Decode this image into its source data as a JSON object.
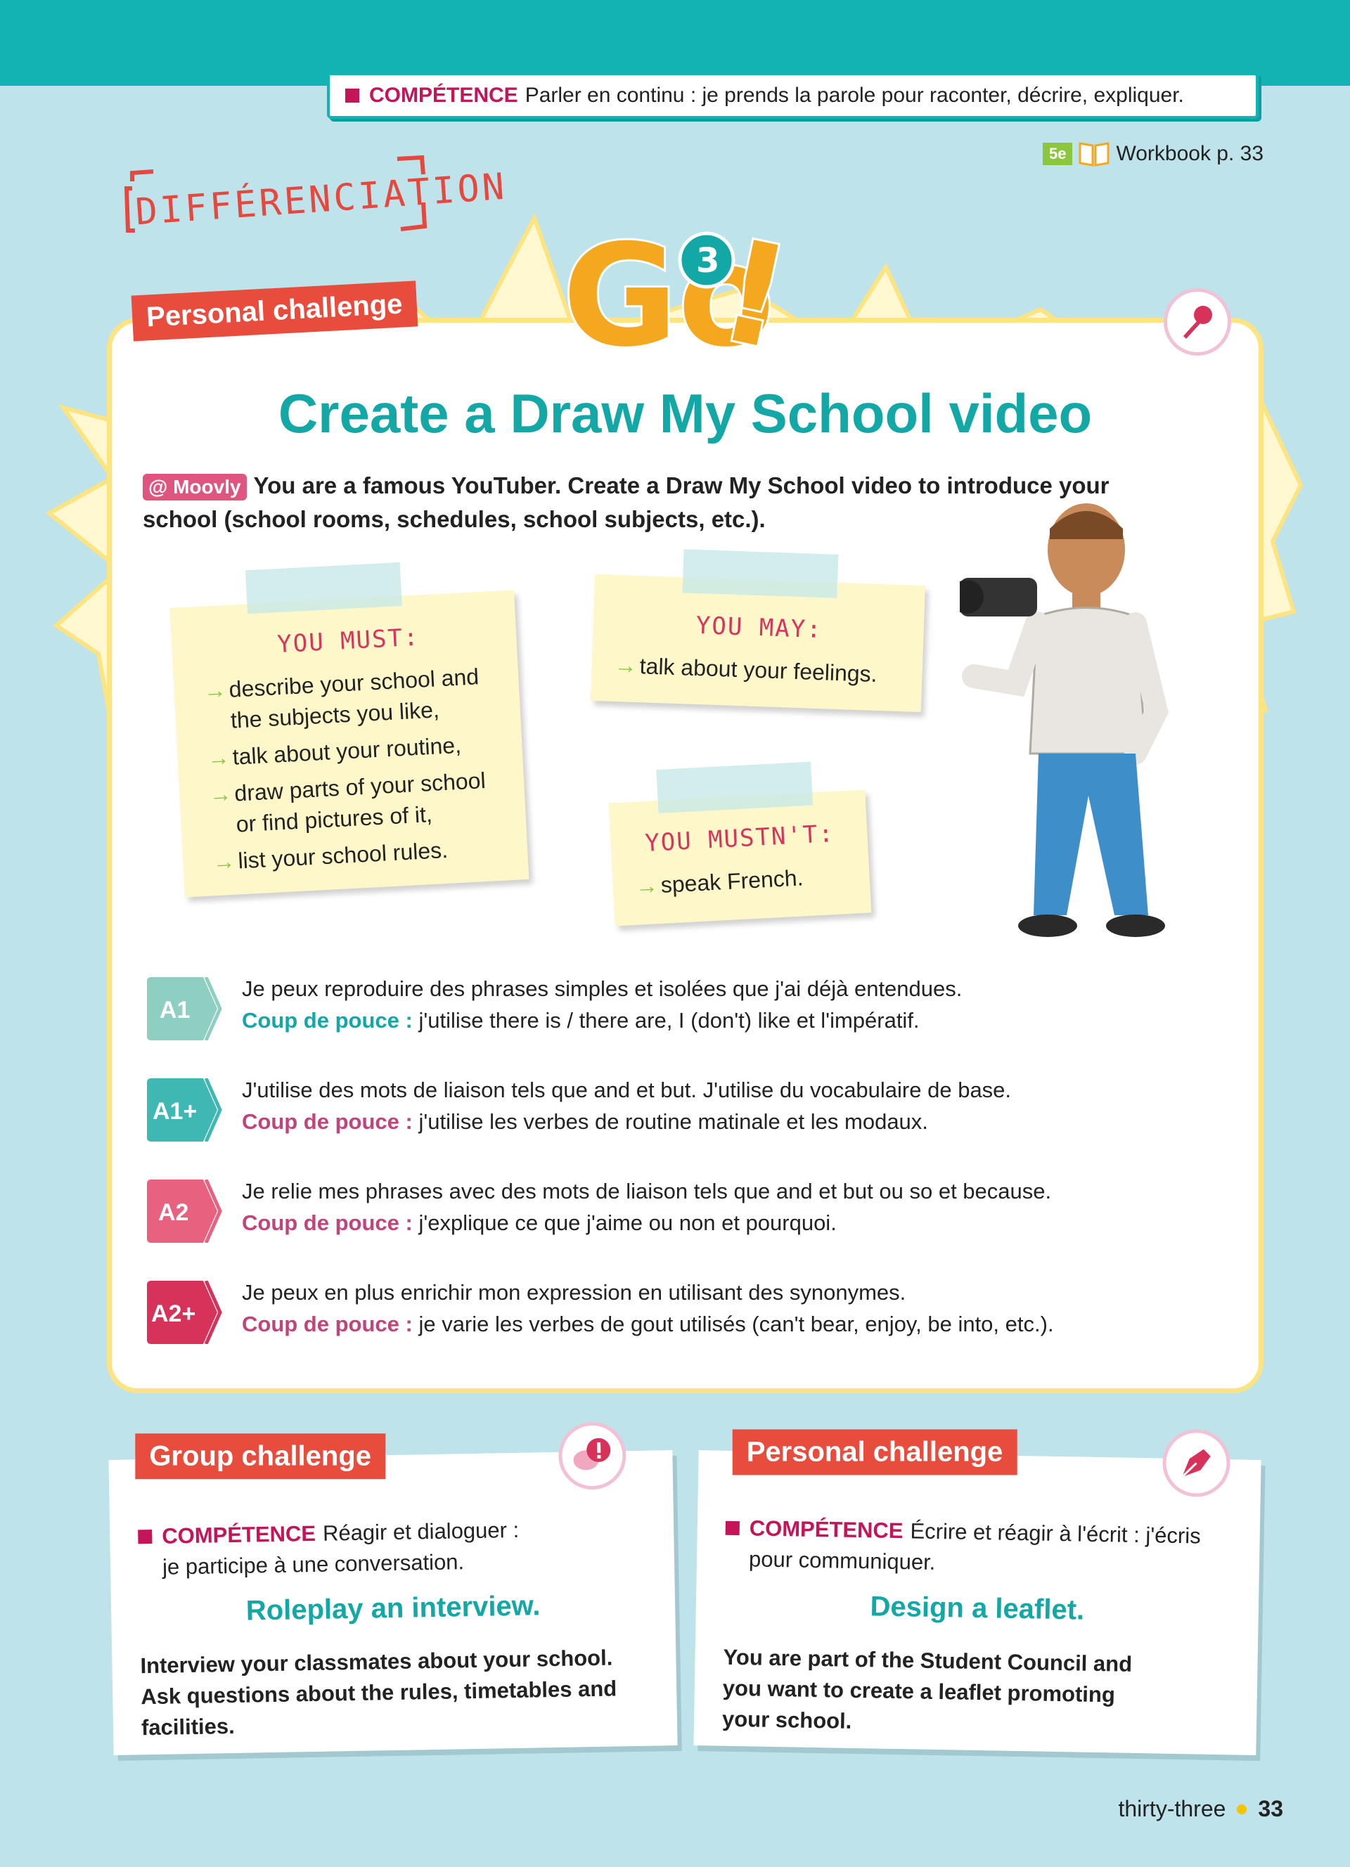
{
  "header": {
    "competence_label": "COMPÉTENCE",
    "competence_text": "Parler en continu : je prends la parole pour raconter, décrire, expliquer.",
    "grade_badge": "5e",
    "workbook": "Workbook p. 33"
  },
  "differenciation": "DIFFÉRENCIATION",
  "logo": {
    "letters": "Go",
    "number": "3",
    "exclaim": "!"
  },
  "main": {
    "tag": "Personal challenge",
    "title": "Create a Draw My School video",
    "moovly": "@ Moovly",
    "intro": "You are a famous YouTuber. Create a Draw My School video to introduce your school (school rooms, schedules, school subjects, etc.).",
    "must": {
      "title": "YOU MUST:",
      "items": [
        "describe your school and the subjects you like,",
        "talk about your routine,",
        "draw parts of your school or find pictures of it,",
        "list your school rules."
      ]
    },
    "may": {
      "title": "YOU MAY:",
      "items": [
        "talk about your feelings."
      ]
    },
    "mustnt": {
      "title": "YOU MUSTN'T:",
      "items": [
        "speak French."
      ]
    },
    "levels": [
      {
        "badge": "A1",
        "color": "#8fcfc2",
        "text": "Je peux reproduire des phrases simples et isolées que j'ai déjà entendues.",
        "pouce_label": "Coup de pouce :",
        "pouce_color": "#13a7a6",
        "pouce_text": "j'utilise there is / there are, I (don't) like et l'impératif."
      },
      {
        "badge": "A1+",
        "color": "#3fb7b2",
        "text": "J'utilise des mots de liaison tels que and et but. J'utilise du vocabulaire de base.",
        "pouce_label": "Coup de pouce :",
        "pouce_color": "#c1457a",
        "pouce_text": "j'utilise les verbes de routine matinale et les modaux."
      },
      {
        "badge": "A2",
        "color": "#e8617f",
        "text": "Je relie mes phrases avec des mots de liaison tels que and et but ou so et because.",
        "pouce_label": "Coup de pouce :",
        "pouce_color": "#c1457a",
        "pouce_text": "j'explique ce que j'aime ou non et pourquoi."
      },
      {
        "badge": "A2+",
        "color": "#d6325a",
        "text": "Je peux en plus enrichir mon expression en utilisant des synonymes.",
        "pouce_label": "Coup de pouce :",
        "pouce_color": "#c1457a",
        "pouce_text": "je varie les verbes de gout utilisés (can't bear, enjoy, be into, etc.)."
      }
    ]
  },
  "group_card": {
    "tag": "Group challenge",
    "competence_label": "COMPÉTENCE",
    "competence_text_1": "Réagir et dialoguer :",
    "competence_text_2": "je participe à une conversation.",
    "subtitle": "Roleplay an interview.",
    "body": "Interview your classmates about your school. Ask questions about the rules, timetables and facilities."
  },
  "personal_card": {
    "tag": "Personal challenge",
    "competence_label": "COMPÉTENCE",
    "competence_text_1": "Écrire et réagir à l'écrit : j'écris",
    "competence_text_2": "pour communiquer.",
    "subtitle": "Design a leaflet.",
    "body": "You are part of the Student Council and you want to create a leaflet promoting your school."
  },
  "footer": {
    "word": "thirty-three",
    "number": "33"
  },
  "colors": {
    "teal": "#13b3b4",
    "magenta": "#c4145a",
    "tag_red": "#e84c3d",
    "note_yellow": "#fdf7c9",
    "card_border": "#fde482",
    "background": "#bfe3ea"
  },
  "icons": [
    "book-icon",
    "microphone-icon",
    "speech-bubbles-icon",
    "fountain-pen-icon",
    "arrow-icon"
  ]
}
